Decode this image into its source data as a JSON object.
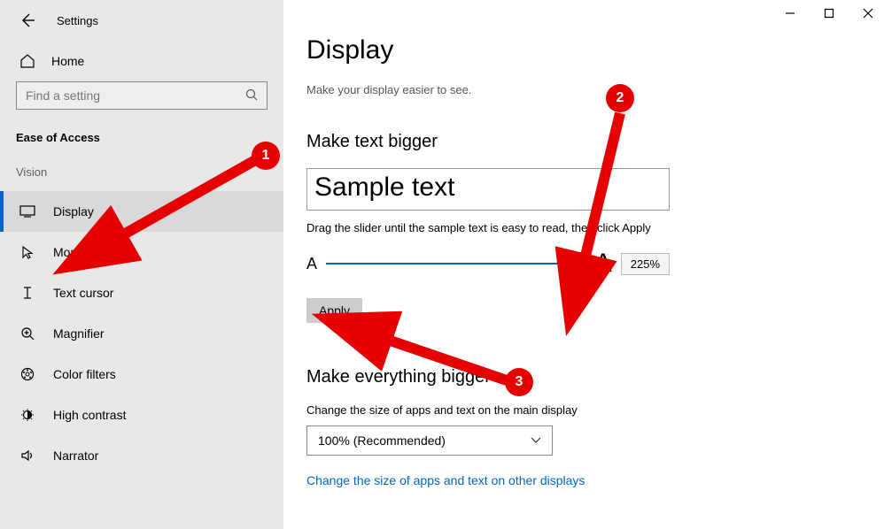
{
  "window": {
    "title": "Settings"
  },
  "sidebar": {
    "home": "Home",
    "search_placeholder": "Find a setting",
    "category": "Ease of Access",
    "group": "Vision",
    "items": [
      {
        "label": "Display",
        "icon": "display-icon"
      },
      {
        "label": "Mouse pointer",
        "icon": "mouse-pointer-icon"
      },
      {
        "label": "Text cursor",
        "icon": "text-cursor-icon"
      },
      {
        "label": "Magnifier",
        "icon": "magnifier-icon"
      },
      {
        "label": "Color filters",
        "icon": "color-filters-icon"
      },
      {
        "label": "High contrast",
        "icon": "high-contrast-icon"
      },
      {
        "label": "Narrator",
        "icon": "narrator-icon"
      }
    ],
    "active_index": 0
  },
  "main": {
    "title": "Display",
    "subtitle": "Make your display easier to see.",
    "section1": {
      "heading": "Make text bigger",
      "sample": "Sample text",
      "instruction": "Drag the slider until the sample text is easy to read, then click Apply",
      "percent": "225%",
      "apply": "Apply"
    },
    "section2": {
      "heading": "Make everything bigger",
      "desc": "Change the size of apps and text on the main display",
      "dropdown_value": "100% (Recommended)",
      "link": "Change the size of apps and text on other displays"
    }
  },
  "annotations": {
    "b1": "1",
    "b2": "2",
    "b3": "3"
  }
}
